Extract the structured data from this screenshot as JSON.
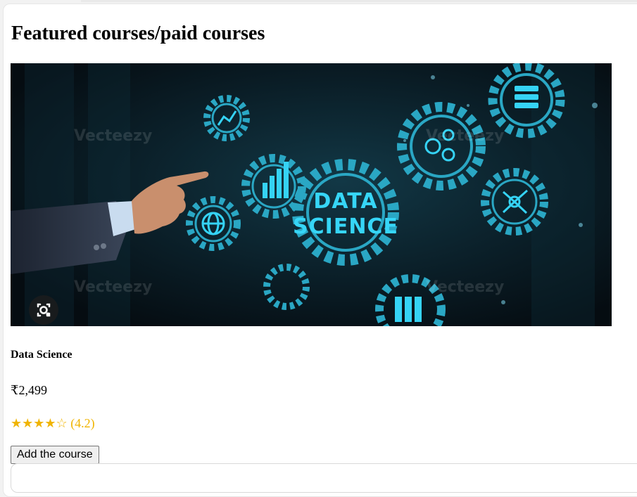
{
  "section": {
    "title": "Featured courses/paid courses"
  },
  "course": {
    "image": {
      "title_line1": "DATA",
      "title_line2": "SCIENCE",
      "watermark": "Vecteezy",
      "accent": "#28c8ec",
      "background": "#07131a"
    },
    "name": "Data Science",
    "price": "₹2,499",
    "rating": {
      "value": 4.2,
      "max": 5,
      "stars_text": "★★★★☆",
      "count_text": "(4.2)",
      "color": "#f0b400"
    },
    "add_button_label": "Add the course"
  },
  "icons": {
    "visual_search": "lens-search-icon"
  }
}
